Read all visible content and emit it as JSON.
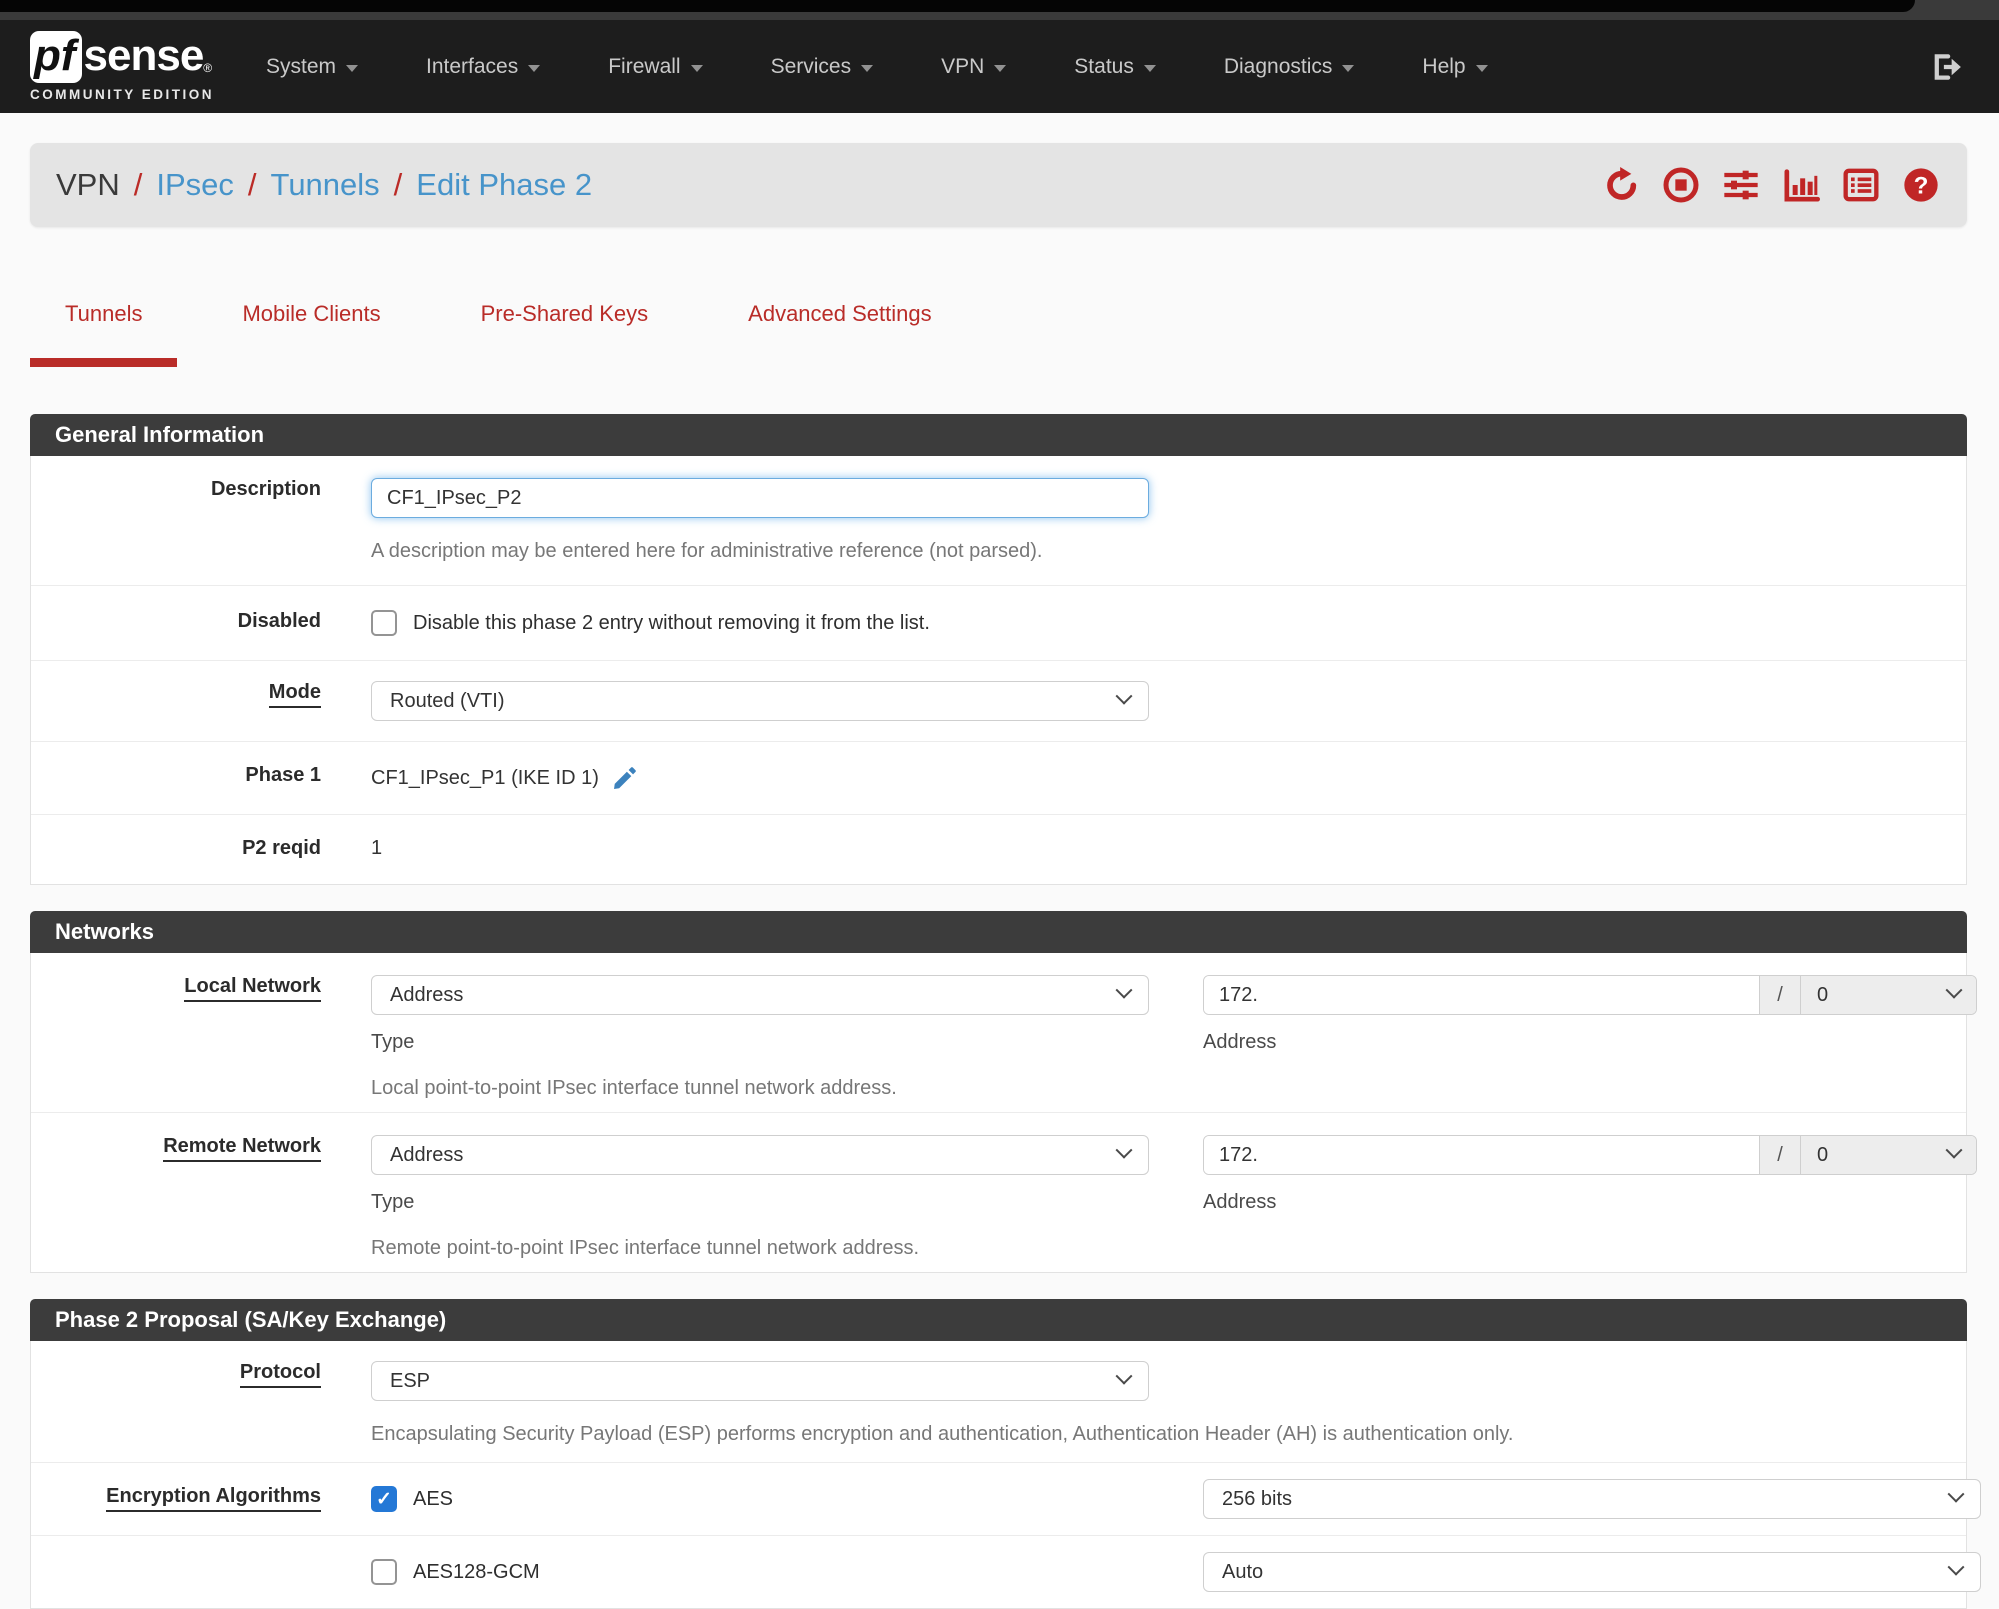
{
  "navbar": {
    "brand": {
      "pf": "pf",
      "sense": "sense",
      "reg": "®",
      "edition": "COMMUNITY EDITION"
    },
    "items": [
      {
        "label": "System"
      },
      {
        "label": "Interfaces"
      },
      {
        "label": "Firewall"
      },
      {
        "label": "Services"
      },
      {
        "label": "VPN"
      },
      {
        "label": "Status"
      },
      {
        "label": "Diagnostics"
      },
      {
        "label": "Help"
      }
    ],
    "logout_icon": "sign-out-icon"
  },
  "breadcrumb": {
    "separator": "/",
    "parts": [
      {
        "label": "VPN"
      },
      {
        "label": "IPsec"
      },
      {
        "label": "Tunnels"
      },
      {
        "label": "Edit Phase 2"
      }
    ],
    "action_icons": [
      "refresh-icon",
      "stop-icon",
      "sliders-icon",
      "bar-chart-icon",
      "log-list-icon",
      "help-icon"
    ]
  },
  "tabs": [
    {
      "label": "Tunnels",
      "active": true
    },
    {
      "label": "Mobile Clients",
      "active": false
    },
    {
      "label": "Pre-Shared Keys",
      "active": false
    },
    {
      "label": "Advanced Settings",
      "active": false
    }
  ],
  "sections": {
    "general": {
      "title": "General Information",
      "description": {
        "label": "Description",
        "value": "CF1_IPsec_P2",
        "help": "A description may be entered here for administrative reference (not parsed)."
      },
      "disabled": {
        "label": "Disabled",
        "checkbox_label": "Disable this phase 2 entry without removing it from the list.",
        "checked": false
      },
      "mode": {
        "label": "Mode",
        "value": "Routed (VTI)"
      },
      "phase1": {
        "label": "Phase 1",
        "value": "CF1_IPsec_P1 (IKE ID 1)",
        "edit_icon": "pencil-icon"
      },
      "p2reqid": {
        "label": "P2 reqid",
        "value": "1"
      }
    },
    "networks": {
      "title": "Networks",
      "local": {
        "label": "Local Network",
        "type_value": "Address",
        "type_caption": "Type",
        "address_value": "172.",
        "address_caption": "Address",
        "separator": "/",
        "mask_value": "0",
        "help": "Local point-to-point IPsec interface tunnel network address."
      },
      "remote": {
        "label": "Remote Network",
        "type_value": "Address",
        "type_caption": "Type",
        "address_value": "172.",
        "address_caption": "Address",
        "separator": "/",
        "mask_value": "0",
        "help": "Remote point-to-point IPsec interface tunnel network address."
      }
    },
    "proposal": {
      "title": "Phase 2 Proposal (SA/Key Exchange)",
      "protocol": {
        "label": "Protocol",
        "value": "ESP",
        "help": "Encapsulating Security Payload (ESP) performs encryption and authentication, Authentication Header (AH) is authentication only."
      },
      "encryption": {
        "label": "Encryption Algorithms",
        "rows": [
          {
            "name": "AES",
            "checked": true,
            "bits": "256 bits"
          },
          {
            "name": "AES128-GCM",
            "checked": false,
            "bits": "Auto"
          }
        ]
      }
    }
  },
  "colors": {
    "accent_red": "#bb2b27",
    "link_blue": "#4794ca",
    "check_blue": "#2478d6",
    "focus_blue": "#6cacdf",
    "header_gray": "#3c3c3c",
    "navbar_black": "#1d1d1d"
  },
  "checkmark": "✓"
}
